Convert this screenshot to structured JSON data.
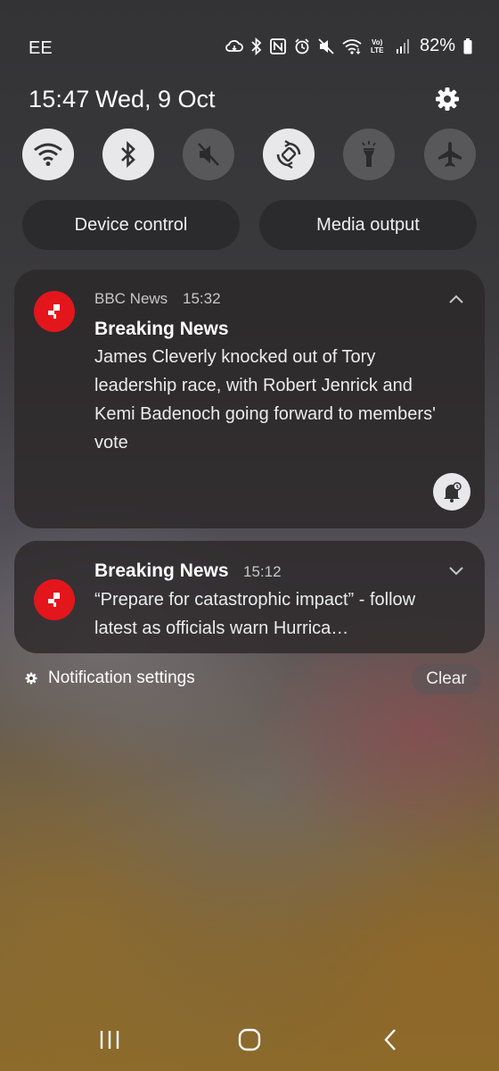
{
  "status_bar": {
    "carrier": "EE",
    "battery": "82%",
    "icons": [
      "cloud-sync-icon",
      "bluetooth-icon",
      "nfc-icon",
      "alarm-icon",
      "mute-icon",
      "wifi-icon",
      "volte-icon",
      "signal-icon",
      "battery-icon"
    ]
  },
  "header": {
    "time": "15:47",
    "date": "Wed, 9 Oct"
  },
  "quick_settings": [
    {
      "name": "wifi",
      "on": true
    },
    {
      "name": "bluetooth",
      "on": true
    },
    {
      "name": "mute",
      "on": false
    },
    {
      "name": "auto-rotate",
      "on": true
    },
    {
      "name": "flashlight",
      "on": false
    },
    {
      "name": "airplane-mode",
      "on": false
    }
  ],
  "pills": {
    "device_control": "Device control",
    "media_output": "Media output"
  },
  "notifications": [
    {
      "app": "BBC News",
      "time": "15:32",
      "title": "Breaking News",
      "body": "James Cleverly knocked out of Tory leadership race, with Robert Jenrick and Kemi Badenoch going forward to members' vote",
      "expanded": true
    },
    {
      "title": "Breaking News",
      "time": "15:12",
      "body": "“Prepare for catastrophic impact” - follow latest as officials warn Hurrica…",
      "expanded": false
    }
  ],
  "footer": {
    "settings_label": "Notification settings",
    "clear_label": "Clear"
  },
  "colors": {
    "bbc_red": "#e3161c",
    "toggle_on": "#e8e8ea",
    "toggle_off": "#58585b"
  }
}
